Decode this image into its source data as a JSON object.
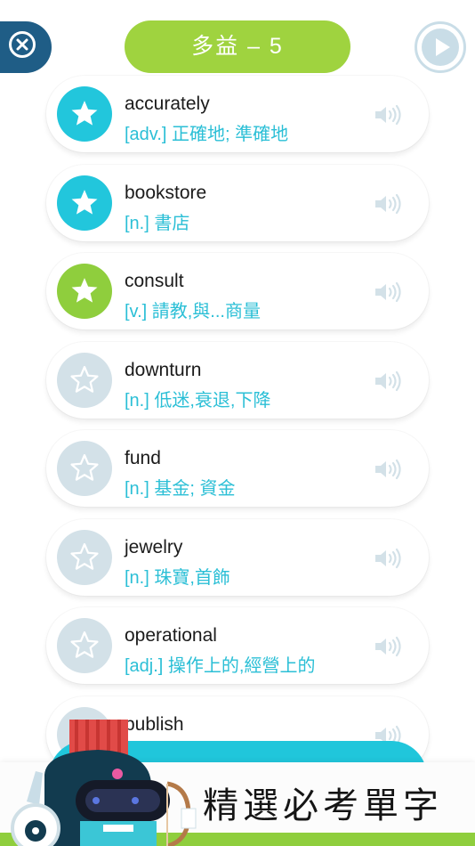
{
  "header": {
    "title": "多益 – 5"
  },
  "words": [
    {
      "word": "accurately",
      "meaning": "[adv.] 正確地; 準確地",
      "star": "teal"
    },
    {
      "word": "bookstore",
      "meaning": "[n.] 書店",
      "star": "teal"
    },
    {
      "word": "consult",
      "meaning": "[v.] 請教,與...商量",
      "star": "green"
    },
    {
      "word": "downturn",
      "meaning": "[n.] 低迷,衰退,下降",
      "star": "empty"
    },
    {
      "word": "fund",
      "meaning": "[n.] 基金; 資金",
      "star": "empty"
    },
    {
      "word": "jewelry",
      "meaning": "[n.] 珠寶,首飾",
      "star": "empty"
    },
    {
      "word": "operational",
      "meaning": "[adj.] 操作上的,經營上的",
      "star": "empty"
    },
    {
      "word": "publish",
      "meaning": "",
      "star": "empty"
    }
  ],
  "banner": {
    "text": "精選必考單字"
  },
  "colors": {
    "teal": "#22c6dc",
    "green": "#8fce3d",
    "navy": "#1f5d86",
    "star_empty": "#d3e1e8"
  },
  "icons": {
    "close": "close-circle-icon",
    "play": "play-circle-icon",
    "star": "star-icon",
    "speaker": "speaker-icon"
  }
}
